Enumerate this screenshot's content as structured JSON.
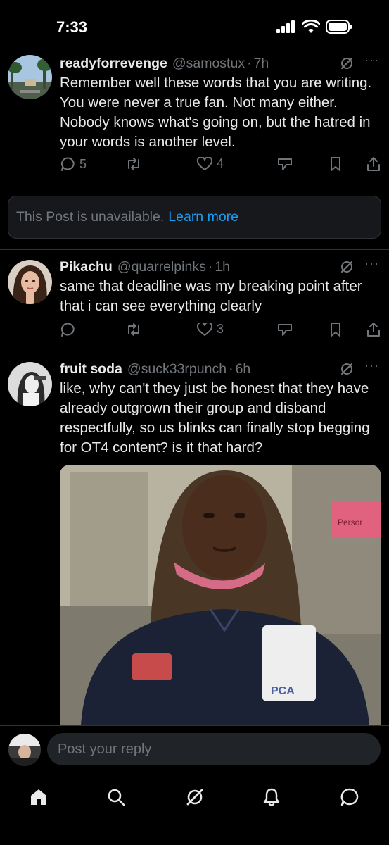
{
  "status_bar": {
    "time": "7:33"
  },
  "tweets": [
    {
      "name": "readyforrevenge",
      "handle": "@samostux",
      "dot": "·",
      "time": "7h",
      "text": "Remember well these words that you are writing. You were never a true fan. Not many either. Nobody knows what's going on, but the hatred in your words is another level.",
      "replies": "5",
      "reposts": "",
      "likes": "4"
    },
    {
      "name": "Pikachu",
      "handle": "@quarrelpinks",
      "dot": "·",
      "time": "1h",
      "text": "same that deadline was my breaking point after that i can see everything clearly",
      "replies": "",
      "reposts": "",
      "likes": "3"
    },
    {
      "name": "fruit soda",
      "handle": "@suck33rpunch",
      "dot": "·",
      "time": "6h",
      "text": "like, why can't they just be honest that they have already outgrown their group and disband respectfully, so us blinks can finally stop begging for OT4 content? is it that hard?",
      "media_badge": "PCA",
      "media_sign": "Persor"
    }
  ],
  "unavailable": {
    "text": "This Post is unavailable.",
    "link": "Learn more"
  },
  "more_label": "···",
  "reply_bar": {
    "placeholder": "Post your reply"
  },
  "icons": [
    "signal-icon",
    "wifi-icon",
    "battery-icon",
    "grok-icon",
    "more-icon",
    "reply-icon",
    "repost-icon",
    "like-icon",
    "analytics-icon",
    "bookmark-icon",
    "share-icon",
    "home-icon",
    "search-icon",
    "bell-icon",
    "messages-icon"
  ],
  "colors": {
    "background": "#000000",
    "text": "#e7e9ea",
    "muted": "#71767b",
    "link": "#1d9bf0",
    "divider": "#2f3336"
  }
}
